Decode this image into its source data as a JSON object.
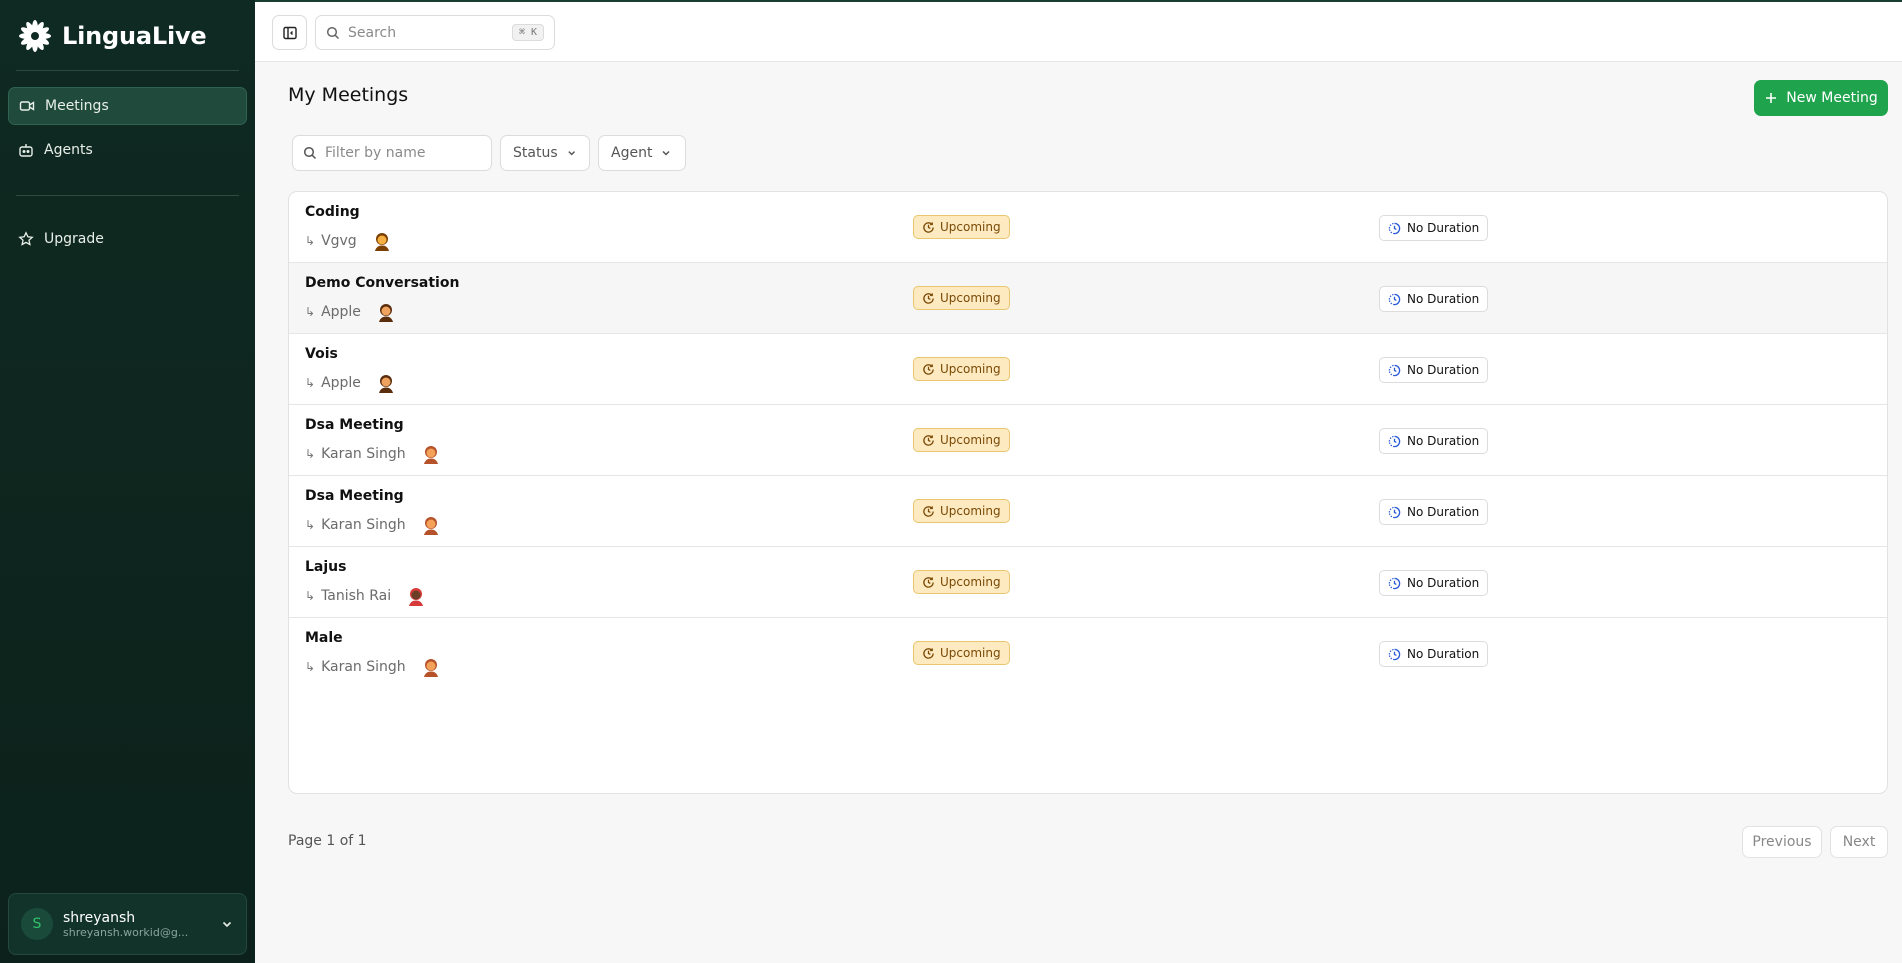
{
  "app": {
    "name": "LinguaLive"
  },
  "sidebar": {
    "items": [
      {
        "label": "Meetings",
        "icon": "video-icon",
        "active": true
      },
      {
        "label": "Agents",
        "icon": "bot-icon",
        "active": false
      },
      {
        "label": "Upgrade",
        "icon": "star-icon",
        "active": false
      }
    ],
    "user": {
      "initial": "S",
      "name": "shreyansh",
      "email": "shreyansh.workid@g..."
    }
  },
  "topbar": {
    "search_placeholder": "Search",
    "shortcut": "⌘ K"
  },
  "main": {
    "title": "My Meetings",
    "new_button": "New Meeting",
    "filter_placeholder": "Filter by name",
    "status_filter": "Status",
    "agent_filter": "Agent",
    "meetings": [
      {
        "name": "Coding",
        "agent": "Vgvg",
        "status": "Upcoming",
        "duration": "No Duration"
      },
      {
        "name": "Demo Conversation",
        "agent": "Apple",
        "status": "Upcoming",
        "duration": "No Duration"
      },
      {
        "name": "Vois",
        "agent": "Apple",
        "status": "Upcoming",
        "duration": "No Duration"
      },
      {
        "name": "Dsa Meeting",
        "agent": "Karan Singh",
        "status": "Upcoming",
        "duration": "No Duration"
      },
      {
        "name": "Dsa Meeting",
        "agent": "Karan Singh",
        "status": "Upcoming",
        "duration": "No Duration"
      },
      {
        "name": "Lajus",
        "agent": "Tanish Rai",
        "status": "Upcoming",
        "duration": "No Duration"
      },
      {
        "name": "Male",
        "agent": "Karan Singh",
        "status": "Upcoming",
        "duration": "No Duration"
      }
    ],
    "pagination": {
      "info": "Page 1 of 1",
      "prev": "Previous",
      "next": "Next"
    }
  },
  "colors": {
    "brand": "#1fa34c",
    "sidebar_bg": "#0f2a22",
    "upcoming_bg": "#fdeac0"
  }
}
